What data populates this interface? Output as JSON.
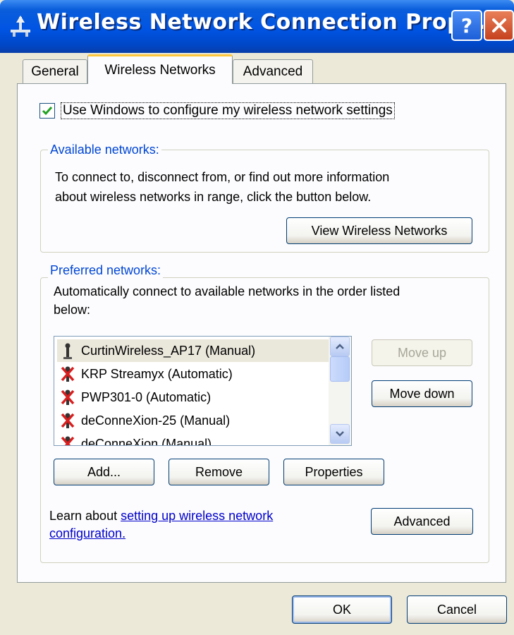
{
  "window": {
    "title": "Wireless Network Connection Prope...",
    "help_icon": "help-icon",
    "close_icon": "close-icon"
  },
  "tabs": [
    {
      "label": "General",
      "active": false
    },
    {
      "label": "Wireless Networks",
      "active": true
    },
    {
      "label": "Advanced",
      "active": false
    }
  ],
  "use_windows": {
    "checked": true,
    "label": "Use Windows to configure my wireless network settings"
  },
  "available": {
    "legend": "Available networks:",
    "description_line1": "To connect to, disconnect from, or find out more information",
    "description_line2": "about wireless networks in range, click the button below.",
    "view_button": "View Wireless Networks"
  },
  "preferred": {
    "legend": "Preferred networks:",
    "description_line1": "Automatically connect to available networks in the order listed",
    "description_line2": "below:",
    "networks": [
      {
        "label": "CurtinWireless_AP17 (Manual)",
        "icon": "network-ap-icon",
        "selected": true
      },
      {
        "label": "KRP Streamyx (Automatic)",
        "icon": "network-unavailable-icon",
        "selected": false
      },
      {
        "label": "PWP301-0 (Automatic)",
        "icon": "network-unavailable-icon",
        "selected": false
      },
      {
        "label": "deConneXion-25 (Manual)",
        "icon": "network-unavailable-icon",
        "selected": false
      },
      {
        "label": "deConneXion (Manual)",
        "icon": "network-unavailable-icon",
        "selected": false
      }
    ],
    "move_up": "Move up",
    "move_down": "Move down",
    "add": "Add...",
    "remove": "Remove",
    "properties": "Properties"
  },
  "learn": {
    "prefix": "Learn about ",
    "link_line1": "setting up wireless network",
    "link_line2": "configuration.",
    "advanced_button": "Advanced"
  },
  "footer": {
    "ok": "OK",
    "cancel": "Cancel"
  }
}
